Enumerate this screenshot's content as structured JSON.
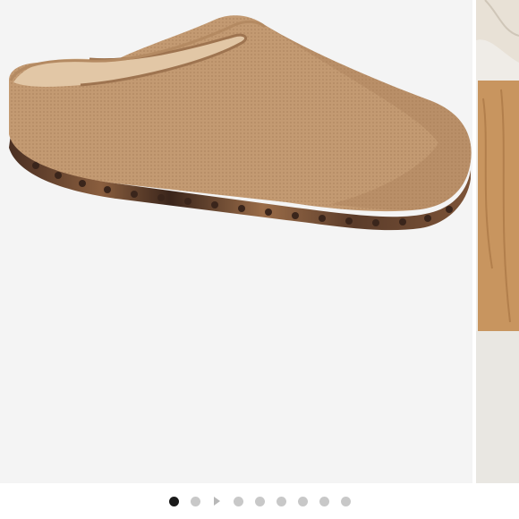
{
  "product": {
    "image_main": "tan-knit-clog-slipper-photo",
    "image_next": "clog-lifestyle-photo-partial",
    "colors": {
      "upper": "#c39a72",
      "upper_shadow": "#a57c56",
      "footbed": "#e2c7a6",
      "sole_tortoise": "#6b4a36",
      "background": "#f4f4f4"
    }
  },
  "carousel": {
    "slide_count": 8,
    "active_index": 0,
    "dot_color": "#c8c8c8",
    "active_dot_color": "#1a1a1a"
  }
}
